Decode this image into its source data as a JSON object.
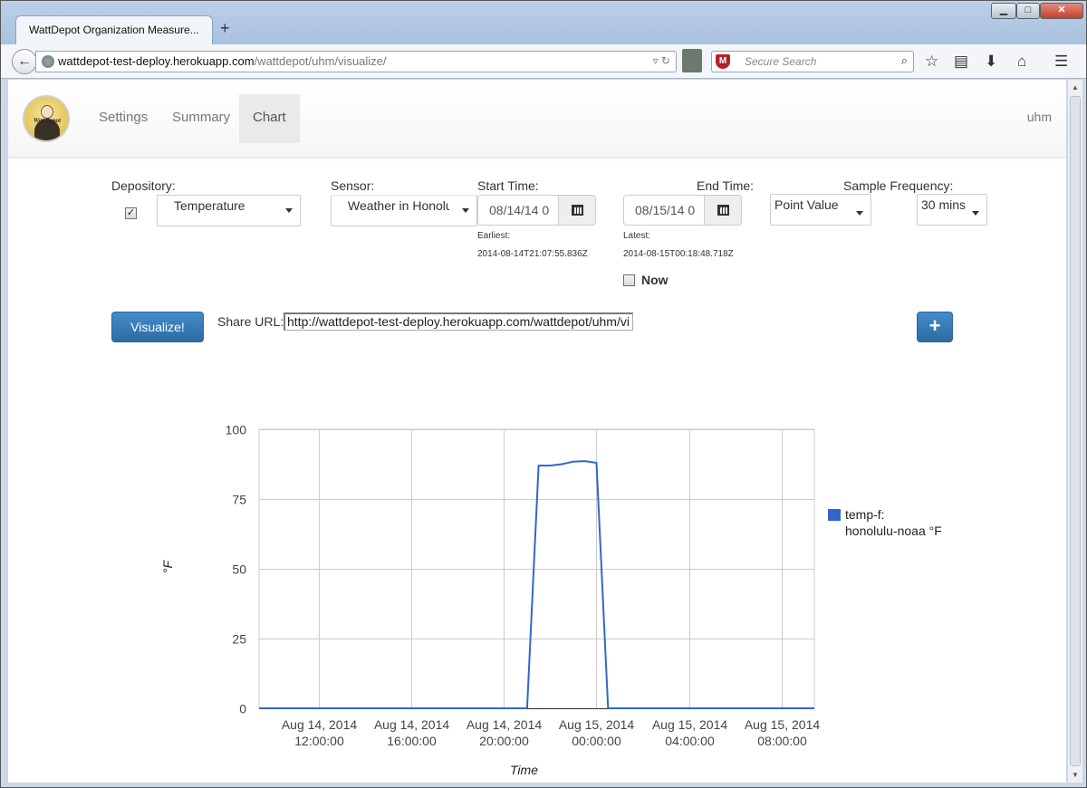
{
  "browser": {
    "tab_title": "WattDepot Organization Measure...",
    "new_tab": "+",
    "window_controls": {
      "minimize": "▁",
      "maximize": "□",
      "close": "✕"
    },
    "url_host": "wattdepot-test-deploy.herokuapp.com",
    "url_path": "/wattdepot/uhm/visualize/",
    "search_placeholder": "Secure Search",
    "back_glyph": "←"
  },
  "nav": {
    "logo_text": "WattDepot",
    "items": [
      "Settings",
      "Summary",
      "Chart"
    ],
    "active": "Chart",
    "user": "uhm"
  },
  "form": {
    "depository_label": "Depository:",
    "depository_value": "Temperature",
    "depository_checked": true,
    "sensor_label": "Sensor:",
    "sensor_value": "Weather in Honolu",
    "start_label": "Start Time:",
    "start_value": "08/14/14 0",
    "earliest_label": "Earliest:",
    "earliest_value": "2014-08-14T21:07:55.836Z",
    "end_label": "End Time:",
    "end_value": "08/15/14 0",
    "latest_label": "Latest:",
    "latest_value": "2014-08-15T00:18:48.718Z",
    "now_label": "Now",
    "now_checked": false,
    "freq_label": "Sample Frequency:",
    "value_type": "Point Value",
    "interval": "30 mins",
    "visualize_button": "Visualize!",
    "share_label": "Share URL:",
    "share_url": "http://wattdepot-test-deploy.herokuapp.com/wattdepot/uhm/vi",
    "add_button": "+"
  },
  "chart_data": {
    "type": "line",
    "xlabel": "Time",
    "ylabel": "°F",
    "ylim": [
      0,
      100
    ],
    "yticks": [
      0,
      25,
      50,
      75,
      100
    ],
    "xlim": [
      "2014-08-14 09:25",
      "2014-08-15 09:25"
    ],
    "xticks": [
      {
        "date": "Aug 14, 2014",
        "time": "12:00:00"
      },
      {
        "date": "Aug 14, 2014",
        "time": "16:00:00"
      },
      {
        "date": "Aug 14, 2014",
        "time": "20:00:00"
      },
      {
        "date": "Aug 15, 2014",
        "time": "00:00:00"
      },
      {
        "date": "Aug 15, 2014",
        "time": "04:00:00"
      },
      {
        "date": "Aug 15, 2014",
        "time": "08:00:00"
      }
    ],
    "grid": true,
    "legend_position": "right",
    "series": [
      {
        "name": "temp-f: honolulu-noaa °F",
        "name_lines": [
          "temp-f:",
          "honolulu-noaa °F"
        ],
        "color": "#3366cc",
        "points": [
          {
            "x": "2014-08-14 09:25",
            "y": 0
          },
          {
            "x": "2014-08-14 21:00",
            "y": 0
          },
          {
            "x": "2014-08-14 21:30",
            "y": 87
          },
          {
            "x": "2014-08-14 22:00",
            "y": 87
          },
          {
            "x": "2014-08-14 22:30",
            "y": 87.5
          },
          {
            "x": "2014-08-14 23:00",
            "y": 88.4
          },
          {
            "x": "2014-08-14 23:30",
            "y": 88.6
          },
          {
            "x": "2014-08-15 00:00",
            "y": 88
          },
          {
            "x": "2014-08-15 00:30",
            "y": 0
          },
          {
            "x": "2014-08-15 09:25",
            "y": 0
          }
        ]
      }
    ]
  }
}
